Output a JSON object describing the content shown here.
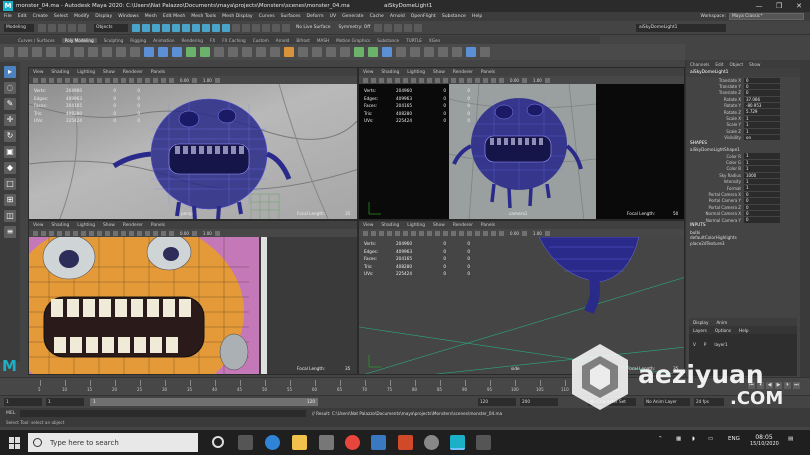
{
  "window": {
    "title_left": "monster_04.ma - Autodesk Maya 2020: C:\\Users\\Nat Palazzo\\Documents\\maya\\projects\\Monsters\\scenes\\monster_04.ma",
    "title_right": "aiSkyDomeLight1",
    "controls": [
      "—",
      "❒",
      "✕"
    ]
  },
  "menu": {
    "items": [
      "File",
      "Edit",
      "Create",
      "Select",
      "Modify",
      "Display",
      "Windows",
      "Mesh",
      "Edit Mesh",
      "Mesh Tools",
      "Mesh Display",
      "Curves",
      "Surfaces",
      "Deform",
      "UV",
      "Generate",
      "Cache",
      "Arnold",
      "OpenFlight",
      "Substance",
      "Help"
    ],
    "workspace_label": "Workspace:",
    "workspace_value": "Maya Classic*"
  },
  "status": {
    "mode": "Modeling",
    "selection_mode": "Objects",
    "no_live_surface": "No Live Surface",
    "symmetry": "Symmetry: Off",
    "selected_object": "aiSkyDomeLight1"
  },
  "shelf": {
    "tabs": [
      "Curves / Surfaces",
      "Poly Modeling",
      "Sculpting",
      "Rigging",
      "Animation",
      "Rendering",
      "FX",
      "FX Caching",
      "Custom",
      "Arnold",
      "Bifrost",
      "MASH",
      "Motion Graphics",
      "Substance",
      "TURTLE",
      "XGen"
    ],
    "active_tab": "Poly Modeling"
  },
  "viewport_menu": [
    "View",
    "Shading",
    "Lighting",
    "Show",
    "Renderer",
    "Panels"
  ],
  "viewport_fields": {
    "near": "0.00",
    "far": "1.00"
  },
  "hud": {
    "labels": [
      "Verts:",
      "Edges:",
      "Faces:",
      "Tris:",
      "UVs:"
    ],
    "values": [
      "204960",
      "409963",
      "204165",
      "408280",
      "225424"
    ],
    "values_b": [
      "0",
      "0",
      "0",
      "0",
      "0"
    ],
    "values_c": [
      "0",
      "0",
      "0",
      "0",
      "0"
    ]
  },
  "viewports": {
    "persp": {
      "camera_label": "persp",
      "focal_label": "Focal Length:",
      "focal_value": "35"
    },
    "camera1": {
      "camera_label": "camera1",
      "focal_label": "Focal Length:",
      "focal_value": "50"
    },
    "render": {
      "focal_label": "Focal Length:",
      "focal_value": "35"
    },
    "side": {
      "camera_label": "side",
      "focal_label": "Focal Length:",
      "focal_value": "35"
    }
  },
  "channel_box": {
    "tabs": [
      "Channels",
      "Edit",
      "Object",
      "Show"
    ],
    "object": "aiSkyDomeLight1",
    "transform_attrs": [
      {
        "name": "Translate X",
        "value": "0"
      },
      {
        "name": "Translate Y",
        "value": "0"
      },
      {
        "name": "Translate Z",
        "value": "0"
      },
      {
        "name": "Rotate X",
        "value": "37.066"
      },
      {
        "name": "Rotate Y",
        "value": "-80.953"
      },
      {
        "name": "Rotate Z",
        "value": "5.729"
      },
      {
        "name": "Scale X",
        "value": "1"
      },
      {
        "name": "Scale Y",
        "value": "1"
      },
      {
        "name": "Scale Z",
        "value": "1"
      },
      {
        "name": "Visibility",
        "value": "on"
      }
    ],
    "shapes_title": "SHAPES",
    "shape_name": "aiSkyDomeLightShape1",
    "shape_attrs": [
      {
        "name": "Color R",
        "value": "1"
      },
      {
        "name": "Color G",
        "value": "1"
      },
      {
        "name": "Color B",
        "value": "1"
      },
      {
        "name": "Sky Radius",
        "value": "1000"
      },
      {
        "name": "Intensity",
        "value": "1"
      },
      {
        "name": "Format",
        "value": "1"
      },
      {
        "name": "Portal Camera X",
        "value": "0"
      },
      {
        "name": "Portal Camera Y",
        "value": "0"
      },
      {
        "name": "Portal Camera Z",
        "value": "0"
      },
      {
        "name": "Normal Camera X",
        "value": "0"
      },
      {
        "name": "Normal Camera Y",
        "value": "0"
      }
    ],
    "inputs_title": "INPUTS",
    "inputs": [
      "bulbi",
      "defaultColorHighlights",
      "place2dTexture3"
    ],
    "layer_tabs": [
      "Display",
      "Anim"
    ],
    "layer_menu": [
      "Layers",
      "Options",
      "Help"
    ],
    "layer_row": {
      "v": "V",
      "p": "P",
      "name": "layer1"
    }
  },
  "time": {
    "ticks": [
      "5",
      "10",
      "15",
      "20",
      "25",
      "30",
      "35",
      "40",
      "45",
      "50",
      "55",
      "60",
      "65",
      "70",
      "75",
      "80",
      "85",
      "90",
      "95",
      "100",
      "105",
      "110",
      "115",
      "120"
    ],
    "start": "1",
    "start_inner": "1",
    "range_start": "1",
    "range_end": "120",
    "end_inner": "120",
    "end": "200",
    "fps": "24 fps",
    "no_character_set": "No Character Set",
    "no_anim_layer": "No Anim Layer"
  },
  "command": {
    "mel": "MEL",
    "result": "// Result: C:\\Users\\Nat Palazzo\\Documents\\maya\\projects\\Monsters\\scenes\\monster_04.ma",
    "help": "Select Tool: select an object"
  },
  "taskbar": {
    "search_placeholder": "Type here to search",
    "language": "ENG",
    "time": "08:05",
    "date": "15/10/2020"
  },
  "watermark": {
    "text": "aeziyuan",
    "sub": ".COM"
  },
  "colors": {
    "accent": "#1ab0c7",
    "panel": "#444444",
    "wire": "#1e1e9c",
    "orange": "#e59a3a",
    "magenta": "#c478b8"
  }
}
